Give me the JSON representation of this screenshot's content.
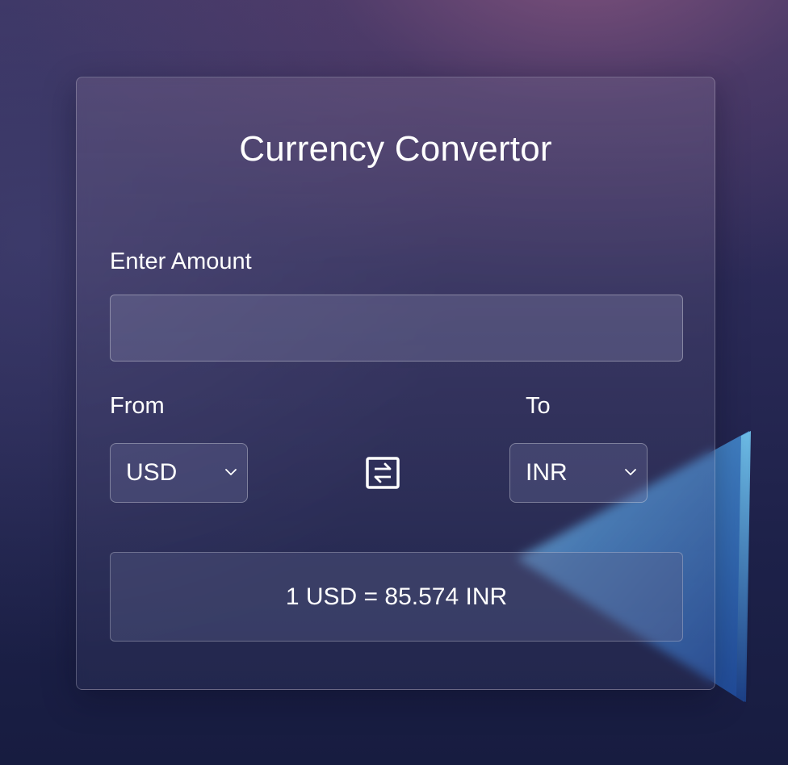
{
  "converter": {
    "title": "Currency Convertor",
    "amount_label": "Enter Amount",
    "amount_value": "",
    "from_label": "From",
    "to_label": "To",
    "from_currency": "USD",
    "to_currency": "INR",
    "result": "1 USD = 85.574 INR"
  },
  "icons": {
    "swap": "swap-arrows-icon",
    "dropdown": "chevron-down-icon"
  },
  "colors": {
    "background_top": "#3c3563",
    "background_bottom": "#171c40",
    "triangle_light": "#7fc6ee",
    "triangle_dark": "#2a57a8",
    "text": "#ffffff"
  }
}
